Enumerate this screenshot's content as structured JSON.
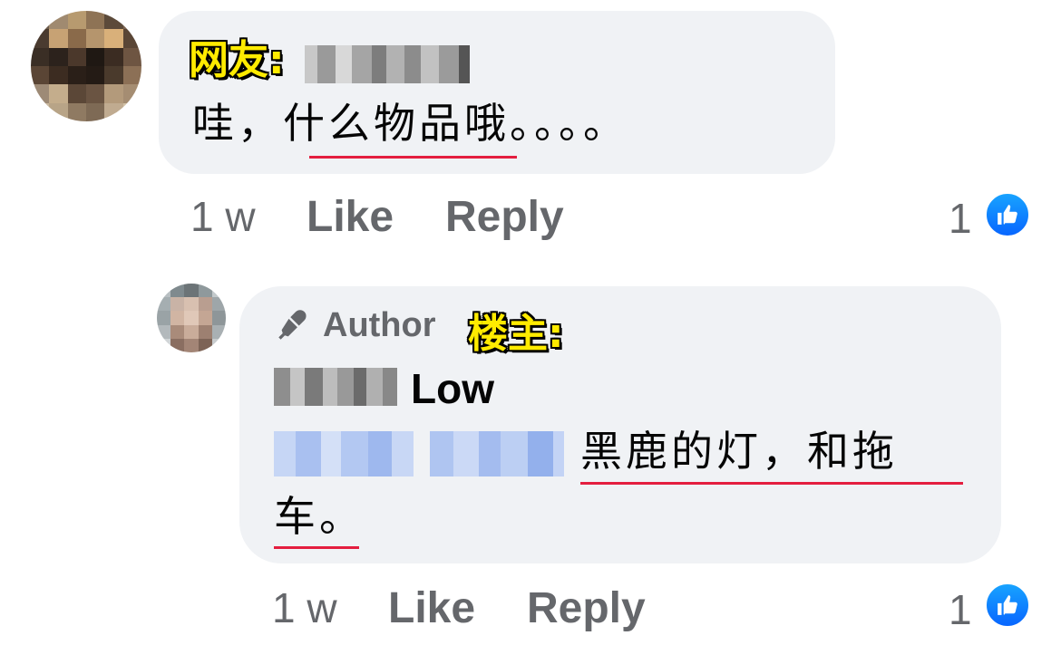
{
  "comment1": {
    "overlay_label": "网友:",
    "text": "哇，什么物品哦。。。。",
    "time": "1 w",
    "like_label": "Like",
    "reply_label": "Reply",
    "like_count": "1"
  },
  "comment2": {
    "author_badge": "Author",
    "overlay_label": "楼主:",
    "name_visible": "Low",
    "text_line1": "黑鹿的灯，和拖",
    "text_line2": "车。",
    "time": "1 w",
    "like_label": "Like",
    "reply_label": "Reply",
    "like_count": "1"
  },
  "icons": {
    "like_badge": "thumbs-up-icon",
    "author_badge": "microphone-icon"
  },
  "colors": {
    "bubble_bg": "#f0f2f5",
    "meta_text": "#65676b",
    "like_blue": "#0866ff",
    "underline_red": "#e41e3f",
    "overlay_yellow": "#ffeb00"
  }
}
